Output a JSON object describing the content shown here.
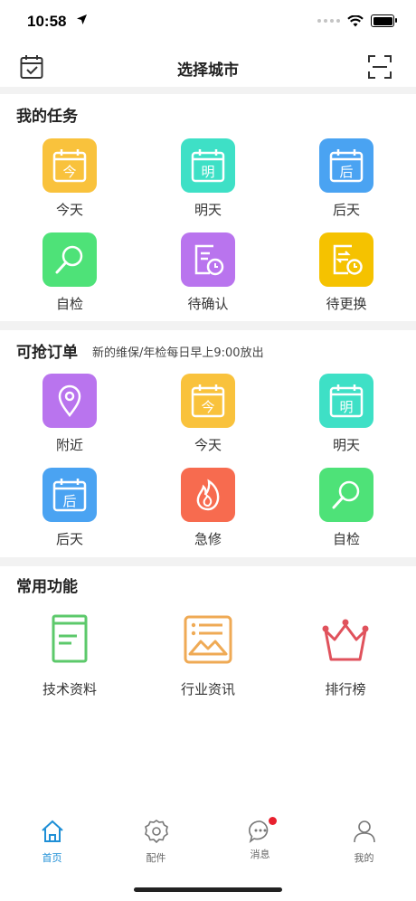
{
  "status": {
    "time": "10:58"
  },
  "nav": {
    "title": "选择城市"
  },
  "my_tasks": {
    "title": "我的任务",
    "items": [
      {
        "label": "今天",
        "icon": "calendar-today-icon",
        "color": "#f9c23c",
        "glyph": "今"
      },
      {
        "label": "明天",
        "icon": "calendar-tomorrow-icon",
        "color": "#3ee0c6",
        "glyph": "明"
      },
      {
        "label": "后天",
        "icon": "calendar-after-tomorrow-icon",
        "color": "#4aa3f2",
        "glyph": "后"
      },
      {
        "label": "自检",
        "icon": "magnifier-icon",
        "color": "#4ee278"
      },
      {
        "label": "待确认",
        "icon": "document-clock-icon",
        "color": "#b974ee"
      },
      {
        "label": "待更换",
        "icon": "exchange-clock-icon",
        "color": "#f5c200"
      }
    ]
  },
  "grab_orders": {
    "title": "可抢订单",
    "subtitle": "新的维保/年检每日早上9:00放出",
    "items": [
      {
        "label": "附近",
        "icon": "location-pin-icon",
        "color": "#b974ee"
      },
      {
        "label": "今天",
        "icon": "calendar-today-icon",
        "color": "#f9c23c",
        "glyph": "今"
      },
      {
        "label": "明天",
        "icon": "calendar-tomorrow-icon",
        "color": "#3ee0c6",
        "glyph": "明"
      },
      {
        "label": "后天",
        "icon": "calendar-after-tomorrow-icon",
        "color": "#4aa3f2",
        "glyph": "后"
      },
      {
        "label": "急修",
        "icon": "flame-icon",
        "color": "#f76b4f"
      },
      {
        "label": "自检",
        "icon": "magnifier-icon",
        "color": "#4ee278"
      }
    ]
  },
  "common": {
    "title": "常用功能",
    "items": [
      {
        "label": "技术资料",
        "icon": "book-icon",
        "color": "#5cc96b"
      },
      {
        "label": "行业资讯",
        "icon": "news-icon",
        "color": "#efaa55"
      },
      {
        "label": "排行榜",
        "icon": "crown-icon",
        "color": "#e0525c"
      }
    ]
  },
  "tabs": [
    {
      "label": "首页",
      "icon": "home-icon",
      "active": true
    },
    {
      "label": "配件",
      "icon": "gear-icon"
    },
    {
      "label": "消息",
      "icon": "message-icon",
      "badge": true
    },
    {
      "label": "我的",
      "icon": "user-icon"
    }
  ],
  "colors": {
    "accent": "#1f8fd6",
    "badge": "#e8202e",
    "separator": "#f2f2f2"
  }
}
